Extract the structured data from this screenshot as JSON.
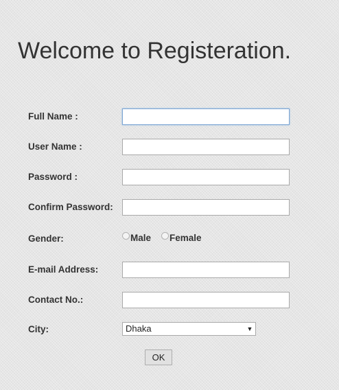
{
  "page": {
    "title": "Welcome to Registeration."
  },
  "form": {
    "full_name": {
      "label": "Full Name :",
      "value": "",
      "placeholder": ""
    },
    "user_name": {
      "label": "User Name :",
      "value": "",
      "placeholder": ""
    },
    "password": {
      "label": "Password :",
      "value": "",
      "placeholder": ""
    },
    "confirm_password": {
      "label": "Confirm Password:",
      "value": "",
      "placeholder": ""
    },
    "gender": {
      "label": "Gender:",
      "options": [
        {
          "label": "Male",
          "checked": false
        },
        {
          "label": "Female",
          "checked": false
        }
      ]
    },
    "email": {
      "label": "E-mail Address:",
      "value": "",
      "placeholder": ""
    },
    "contact": {
      "label": "Contact No.:",
      "value": "",
      "placeholder": ""
    },
    "city": {
      "label": "City:",
      "selected": "Dhaka",
      "icon": "chevron-down-icon"
    },
    "submit_label": "OK"
  },
  "colors": {
    "background": "#e6e6e6",
    "text": "#333333",
    "focus_border": "#7ea6d4",
    "button_bg": "#e1e1e1"
  }
}
